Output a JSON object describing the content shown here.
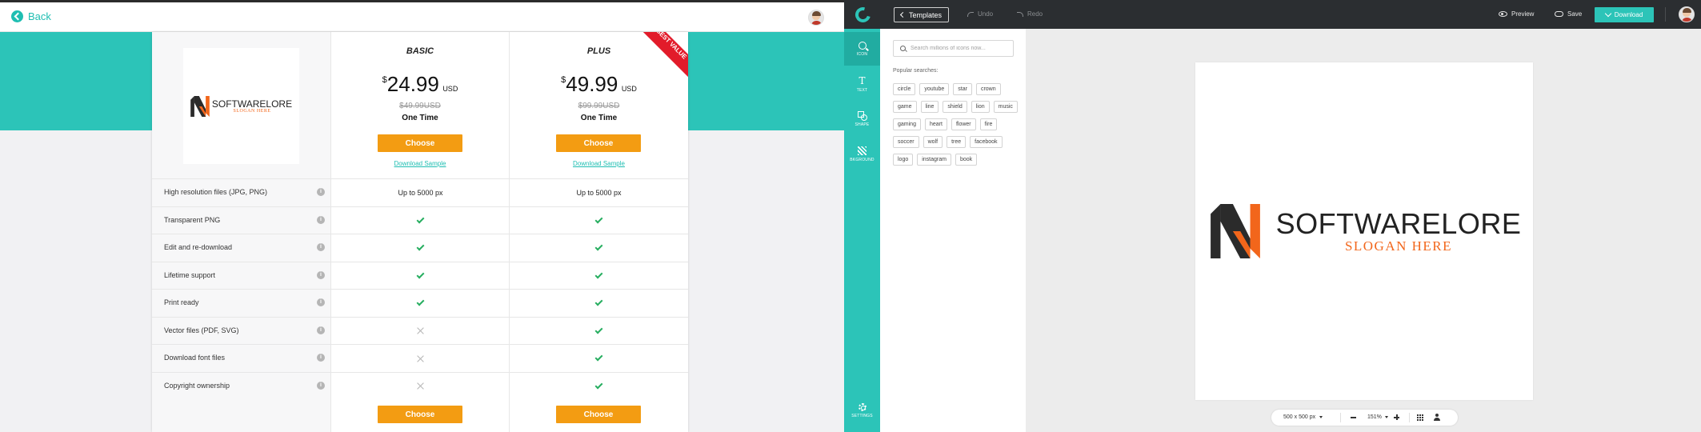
{
  "left": {
    "back_label": "Back",
    "product_logo": {
      "name": "SOFTWARELORE",
      "slogan": "SLOGAN HERE"
    },
    "plans": [
      {
        "name": "BASIC",
        "currency_symbol": "$",
        "price": "24.99",
        "currency": "USD",
        "old_price": "$49.99USD",
        "billing": "One Time",
        "choose_label": "Choose",
        "download_sample_label": "Download Sample",
        "ribbon": ""
      },
      {
        "name": "PLUS",
        "currency_symbol": "$",
        "price": "49.99",
        "currency": "USD",
        "old_price": "$99.99USD",
        "billing": "One Time",
        "choose_label": "Choose",
        "download_sample_label": "Download Sample",
        "ribbon": "BEST VALUE"
      }
    ],
    "features": [
      {
        "label": "High resolution files (JPG, PNG)",
        "basic": "Up to 5000 px",
        "plus": "Up to 5000 px"
      },
      {
        "label": "Transparent PNG",
        "basic": "check",
        "plus": "check"
      },
      {
        "label": "Edit and re-download",
        "basic": "check",
        "plus": "check"
      },
      {
        "label": "Lifetime support",
        "basic": "check",
        "plus": "check"
      },
      {
        "label": "Print ready",
        "basic": "check",
        "plus": "check"
      },
      {
        "label": "Vector files (PDF, SVG)",
        "basic": "cross",
        "plus": "check"
      },
      {
        "label": "Download font files",
        "basic": "cross",
        "plus": "check"
      },
      {
        "label": "Copyright ownership",
        "basic": "cross",
        "plus": "check"
      }
    ],
    "info_glyph": "i"
  },
  "editor": {
    "templates_label": "Templates",
    "undo_label": "Undo",
    "redo_label": "Redo",
    "preview_label": "Preview",
    "save_label": "Save",
    "download_label": "Download",
    "sidebar": {
      "icon_label": "ICON",
      "text_label": "TEXT",
      "text_glyph": "T",
      "shape_label": "SHAPE",
      "background_label": "BKGROUND",
      "settings_label": "SETTINGS"
    },
    "search": {
      "placeholder": "Search millions of icons now..."
    },
    "popular_title": "Popular searches:",
    "tags": [
      "circle",
      "youtube",
      "star",
      "crown",
      "game",
      "line",
      "shield",
      "lion",
      "music",
      "gaming",
      "heart",
      "flower",
      "fire",
      "soccer",
      "wolf",
      "tree",
      "facebook",
      "logo",
      "instagram",
      "book"
    ],
    "canvas_logo": {
      "name": "SOFTWARELORE",
      "slogan": "SLOGAN HERE"
    },
    "zoom": {
      "size": "500 x 500 px",
      "level": "151%"
    }
  },
  "colors": {
    "teal": "#2cc4b8",
    "orange_button": "#f39c12",
    "ribbon_red": "#e21b2a",
    "check_green": "#27ae60",
    "logo_orange": "#f2661b",
    "logo_dark": "#2b2b2b",
    "topbar_dark": "#2b2e31"
  },
  "icons": [
    "back-arrow-icon",
    "avatar",
    "info-icon",
    "check-icon",
    "cross-icon",
    "app-logo-icon",
    "chevron-left-icon",
    "undo-icon",
    "redo-icon",
    "eye-icon",
    "cloud-icon",
    "download-icon",
    "search-icon",
    "text-icon",
    "shape-icon",
    "background-icon",
    "gear-icon",
    "minus-icon",
    "plus-icon",
    "grid-icon",
    "person-icon"
  ]
}
